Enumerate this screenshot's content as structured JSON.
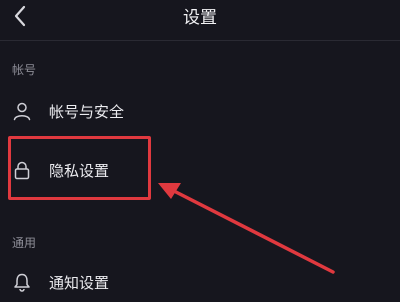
{
  "header": {
    "title": "设置",
    "back_icon": "chevron-left-icon"
  },
  "sections": [
    {
      "label": "帐号",
      "items": [
        {
          "label": "帐号与安全",
          "icon": "user-icon"
        },
        {
          "label": "隐私设置",
          "icon": "lock-icon",
          "highlighted": true
        }
      ]
    },
    {
      "label": "通用",
      "items": [
        {
          "label": "通知设置",
          "icon": "bell-icon"
        }
      ]
    }
  ],
  "colors": {
    "background": "#16161e",
    "annotation": "#e0393f",
    "text": "#ececf0",
    "muted": "#8d8d97"
  }
}
